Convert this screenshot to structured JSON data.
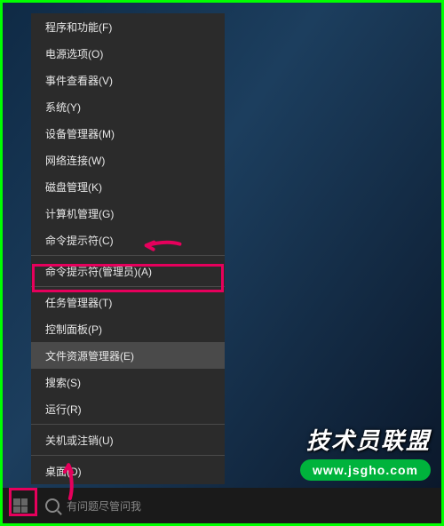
{
  "context_menu": {
    "items": [
      {
        "label": "程序和功能(F)",
        "hovered": false
      },
      {
        "label": "电源选项(O)",
        "hovered": false
      },
      {
        "label": "事件查看器(V)",
        "hovered": false
      },
      {
        "label": "系统(Y)",
        "hovered": false
      },
      {
        "label": "设备管理器(M)",
        "hovered": false
      },
      {
        "label": "网络连接(W)",
        "hovered": false
      },
      {
        "label": "磁盘管理(K)",
        "hovered": false
      },
      {
        "label": "计算机管理(G)",
        "hovered": false
      },
      {
        "label": "命令提示符(C)",
        "hovered": false
      },
      {
        "label": "命令提示符(管理员)(A)",
        "hovered": false,
        "highlighted": true
      },
      {
        "label": "任务管理器(T)",
        "hovered": false
      },
      {
        "label": "控制面板(P)",
        "hovered": false
      },
      {
        "label": "文件资源管理器(E)",
        "hovered": true
      },
      {
        "label": "搜索(S)",
        "hovered": false
      },
      {
        "label": "运行(R)",
        "hovered": false
      },
      {
        "label": "关机或注销(U)",
        "hovered": false,
        "has_submenu": true
      },
      {
        "label": "桌面(D)",
        "hovered": false
      }
    ],
    "separators_after": [
      8,
      9,
      14,
      15
    ]
  },
  "taskbar": {
    "search_placeholder": "有问题尽管问我"
  },
  "watermark": {
    "title": "技术员联盟",
    "url": "www.jsgho.com"
  },
  "annotation": {
    "arrow_color": "#e6005c",
    "highlight_color": "#e6005c"
  }
}
